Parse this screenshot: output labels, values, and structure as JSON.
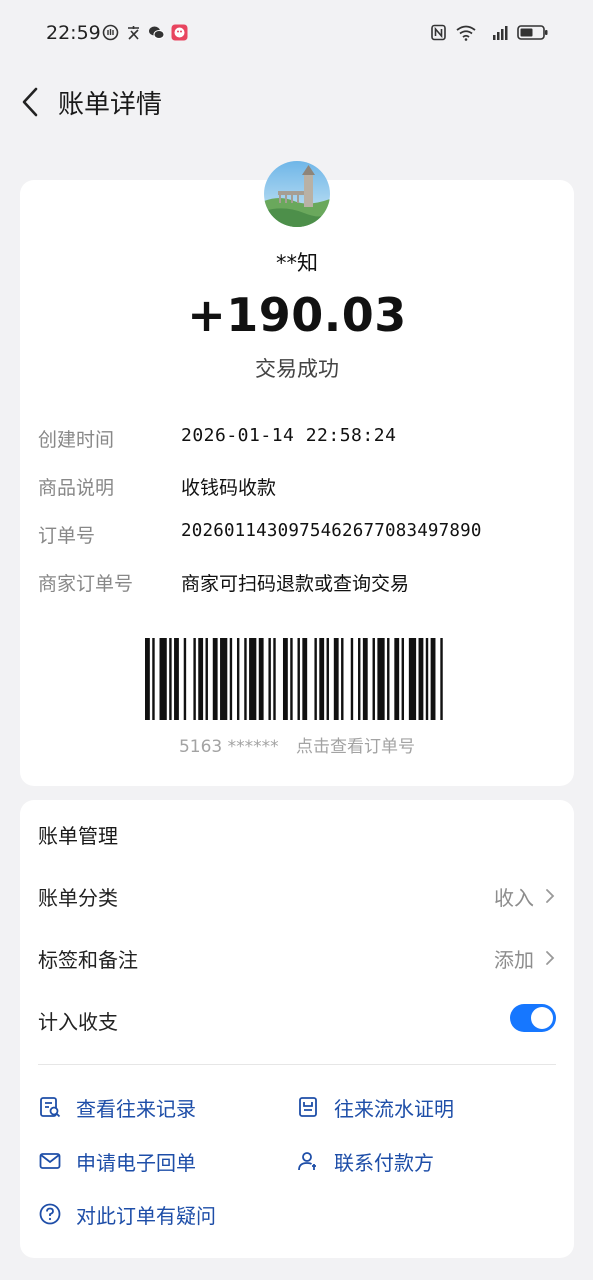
{
  "status_bar": {
    "time": "22:59",
    "left_icons": [
      "gesture-icon",
      "text-icon",
      "wechat-icon",
      "app-badge-icon"
    ],
    "right_icons": [
      "nfc-icon",
      "wifi-icon",
      "signal-5g-icon",
      "battery-icon"
    ],
    "signal_label": "5G",
    "wifi_label": "6"
  },
  "header": {
    "title": "账单详情",
    "back_icon": "chevron-left-icon"
  },
  "transaction": {
    "payer": "**知",
    "amount": "+190.03",
    "status": "交易成功",
    "details": [
      {
        "label": "创建时间",
        "value": "2026-01-14 22:58:24"
      },
      {
        "label": "商品说明",
        "value": "收钱码收款"
      },
      {
        "label": "订单号",
        "value": "20260114309754626770834978​90"
      },
      {
        "label": "商家订单号",
        "value": "商家可扫码退款或查询交易"
      }
    ],
    "barcode": {
      "prefix": "5163 ******",
      "hint": "点击查看订单号"
    }
  },
  "manage": {
    "title": "账单管理",
    "rows": [
      {
        "label": "账单分类",
        "value": "收入"
      },
      {
        "label": "标签和备注",
        "value": "添加"
      },
      {
        "label": "计入收支",
        "toggle_on": true
      }
    ],
    "actions": [
      {
        "label": "查看往来记录",
        "icon": "record-search-icon"
      },
      {
        "label": "往来流水证明",
        "icon": "document-icon"
      },
      {
        "label": "申请电子回单",
        "icon": "mail-icon"
      },
      {
        "label": "联系付款方",
        "icon": "contact-person-icon"
      },
      {
        "label": "对此订单有疑问",
        "icon": "question-icon"
      }
    ]
  },
  "colors": {
    "accent": "#1677ff",
    "action_text": "#1e4ea8",
    "background": "#f2f2f4",
    "card": "#ffffff"
  }
}
